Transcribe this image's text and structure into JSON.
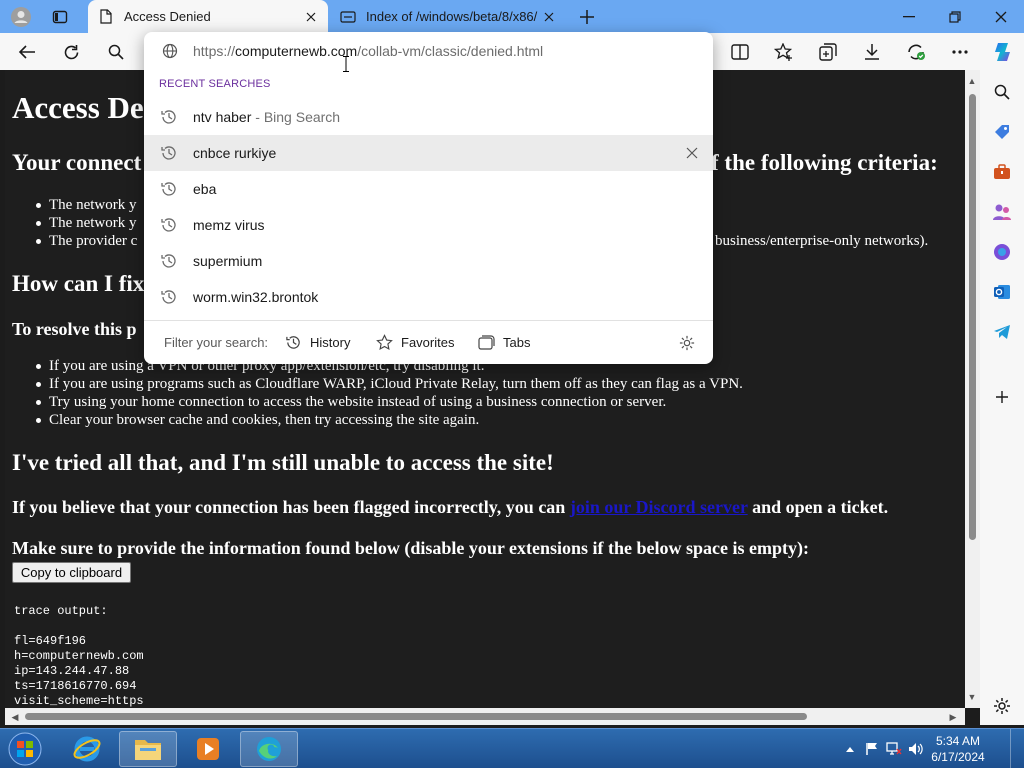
{
  "browser": {
    "tabs": [
      {
        "title": "Access Denied",
        "active": true
      },
      {
        "title": "Index of /windows/beta/8/x86/",
        "active": false
      }
    ],
    "address": {
      "prefix": "https://",
      "domain": "computernewb.com",
      "path": "/collab-vm/classic/denied.html"
    },
    "omnibox": {
      "section_label": "RECENT SEARCHES",
      "items": [
        {
          "text": "ntv haber",
          "suffix": " - Bing Search"
        },
        {
          "text": "cnbce rurkiye"
        },
        {
          "text": "eba"
        },
        {
          "text": "memz virus"
        },
        {
          "text": "supermium"
        },
        {
          "text": "worm.win32.brontok"
        }
      ],
      "filter_label": "Filter your search:",
      "filters": [
        "History",
        "Favorites",
        "Tabs"
      ]
    }
  },
  "page": {
    "title": "Access Denied",
    "title_visible": "Access De",
    "conn_left": "Your connect",
    "conn_right": "f the following criteria:",
    "bullets1": [
      "The network y",
      "The network y",
      "The provider c"
    ],
    "bullet3_right": "business/enterprise-only networks).",
    "how_heading": "How can I fix",
    "resolve_heading": "To resolve this p",
    "bullets2": [
      "If you are using a VPN or other proxy app/extension/etc, try disabling it.",
      "If you are using programs such as Cloudflare WARP, iCloud Private Relay, turn them off as they can flag as a VPN.",
      "Try using your home connection to access the website instead of using a business connection or server.",
      "Clear your browser cache and cookies, then try accessing the site again."
    ],
    "tried_heading": "I've tried all that, and I'm still unable to access the site!",
    "believe_text": "If you believe that your connection has been flagged incorrectly, you can",
    "believe_link": "join our Discord server",
    "believe_end": " and open a ticket.",
    "provide_text": "Make sure to provide the information found below (disable your extensions if the below space is empty):",
    "copy_button": "Copy to clipboard",
    "trace_lines": [
      "trace output:",
      "",
      "fl=649f196",
      "h=computernewb.com",
      "ip=143.244.47.88",
      "ts=1718616770.694",
      "visit_scheme=https"
    ]
  },
  "taskbar": {
    "time": "5:34 AM",
    "date": "6/17/2024"
  },
  "colors": {
    "tab_strip": "#6aa8f2",
    "page_bg": "#1e1e1e",
    "link": "#1a17c8",
    "section_label": "#6b2f9e",
    "taskbar": "#1d4f8e"
  },
  "icons": [
    "profile-icon",
    "tab-actions-icon",
    "page-icon",
    "close-icon",
    "new-tab-icon",
    "minimize-icon",
    "restore-icon",
    "back-icon",
    "refresh-icon",
    "search-icon",
    "split-screen-icon",
    "favorites-icon",
    "collections-icon",
    "downloads-icon",
    "extensions-icon",
    "more-icon",
    "copilot-icon",
    "globe-icon",
    "clock-icon",
    "gear-icon",
    "start-orb-icon",
    "ie-icon",
    "explorer-icon",
    "media-player-icon",
    "edge-icon"
  ]
}
